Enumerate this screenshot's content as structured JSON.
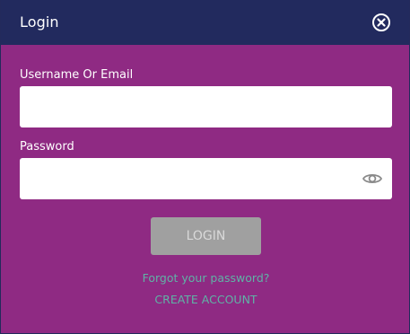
{
  "header": {
    "title": "Login",
    "close_icon": "close-circle-icon"
  },
  "form": {
    "username_label": "Username Or Email",
    "username_value": "",
    "password_label": "Password",
    "password_value": "",
    "password_toggle_icon": "eye-icon"
  },
  "actions": {
    "login_label": "LOGIN",
    "forgot_label": "Forgot your password?",
    "create_label": "CREATE ACCOUNT"
  },
  "colors": {
    "header_bg": "#222a5e",
    "body_bg": "#8f2a83",
    "button_bg": "#a0a0a0",
    "link": "#5fb3a6"
  }
}
